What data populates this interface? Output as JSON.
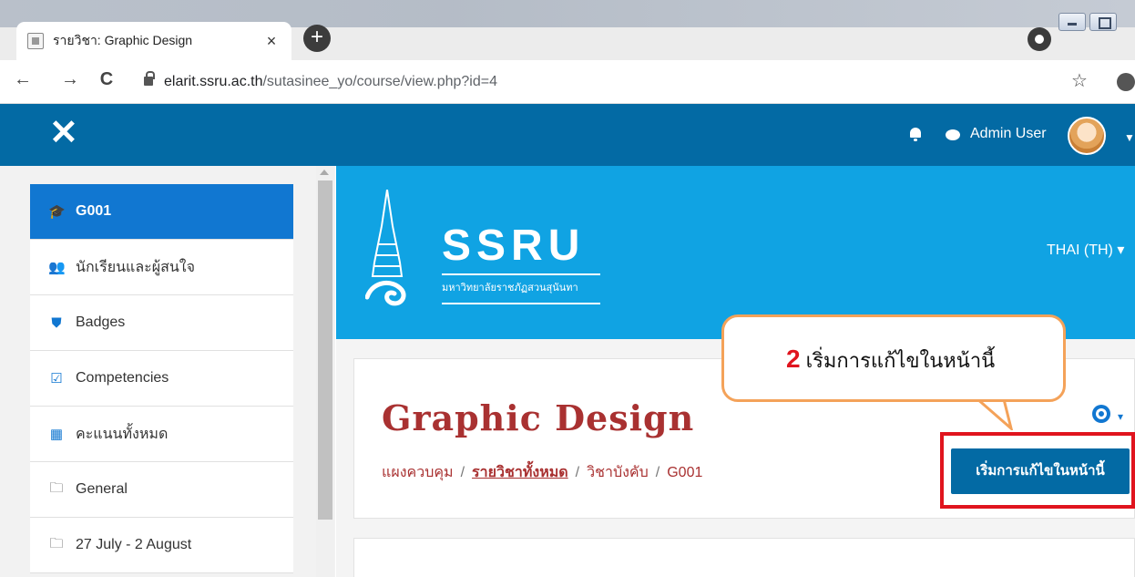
{
  "browser": {
    "tab_title": "รายวิชา: Graphic Design",
    "tab_close": "×",
    "new_tab": "+",
    "url_host": "elarit.ssru.ac.th",
    "url_path": "/sutasinee_yo/course/view.php?id=4",
    "back": "←",
    "forward": "→",
    "reload": "C",
    "bookmark": "☆"
  },
  "navbar": {
    "close_glyph": "✕",
    "user_name": "Admin User",
    "user_caret": "▼"
  },
  "drawer": {
    "items": [
      {
        "label": "G001",
        "icon": "graduation-cap-icon",
        "glyph": "🎓"
      },
      {
        "label": "นักเรียนและผู้สนใจ",
        "icon": "users-icon",
        "glyph": "👥"
      },
      {
        "label": "Badges",
        "icon": "shield-icon",
        "glyph": "⛊"
      },
      {
        "label": "Competencies",
        "icon": "checkbox-icon",
        "glyph": "☑"
      },
      {
        "label": "คะแนนทั้งหมด",
        "icon": "table-icon",
        "glyph": "▦"
      },
      {
        "label": "General",
        "icon": "folder-icon",
        "glyph": "🗀"
      },
      {
        "label": "27 July - 2 August",
        "icon": "folder-icon",
        "glyph": "🗀"
      }
    ]
  },
  "hero": {
    "logo_text": "SSRU",
    "logo_sub": "มหาวิทยาลัยราชภัฏสวนสุนันทา",
    "language": "THAI (TH) ▾"
  },
  "course": {
    "title": "Graphic Design",
    "gear_caret": "▾",
    "breadcrumb": {
      "home": "แผงควบคุม",
      "all_courses": "รายวิชาทั้งหมด",
      "category": "วิชาบังคับ",
      "current": "G001",
      "separator": "/"
    },
    "edit_button": "เริ่มการแก้ไขในหน้านี้"
  },
  "callout": {
    "step_number": "2",
    "text": "เริ่มการแก้ไขในหน้านี้"
  },
  "colors": {
    "navbar": "#036aa4",
    "hero": "#10a3e3",
    "drawer_active": "#1177d1",
    "title": "#a93131",
    "highlight": "#e0141e",
    "callout_border": "#f4a259"
  }
}
